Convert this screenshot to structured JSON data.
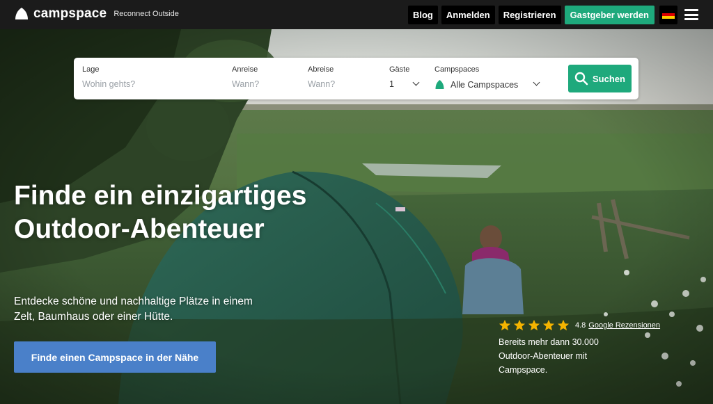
{
  "brand": {
    "name": "campspace",
    "tagline": "Reconnect Outside"
  },
  "nav": {
    "blog": "Blog",
    "login": "Anmelden",
    "register": "Registrieren",
    "host": "Gastgeber werden",
    "flag_colors": [
      "#000000",
      "#dd0000",
      "#ffce00"
    ],
    "menu_icon": "hamburger-menu-icon"
  },
  "search": {
    "location": {
      "label": "Lage",
      "placeholder": "Wohin gehts?"
    },
    "arrival": {
      "label": "Anreise",
      "placeholder": "Wann?"
    },
    "departure": {
      "label": "Abreise",
      "placeholder": "Wann?"
    },
    "guests": {
      "label": "Gäste",
      "value": "1"
    },
    "campspaces": {
      "label": "Campspaces",
      "value": "Alle Campspaces"
    },
    "button": "Suchen"
  },
  "hero": {
    "headline": "Finde ein einzigartiges Outdoor-Abenteuer",
    "subline": "Entdecke schöne und nachhaltige Plätze in einem Zelt, Baumhaus oder einer Hütte.",
    "cta": "Finde einen Campspace in der Nähe"
  },
  "rating": {
    "stars": 5,
    "value": "4.8",
    "source": "Google Rezensionen",
    "text": "Bereits mehr dann 30.000 Outdoor-Abenteuer mit Campspace."
  },
  "colors": {
    "accent": "#1ea97c",
    "cta": "#4a80c9",
    "topbar": "#1b1b1b",
    "star": "#f5b400"
  }
}
